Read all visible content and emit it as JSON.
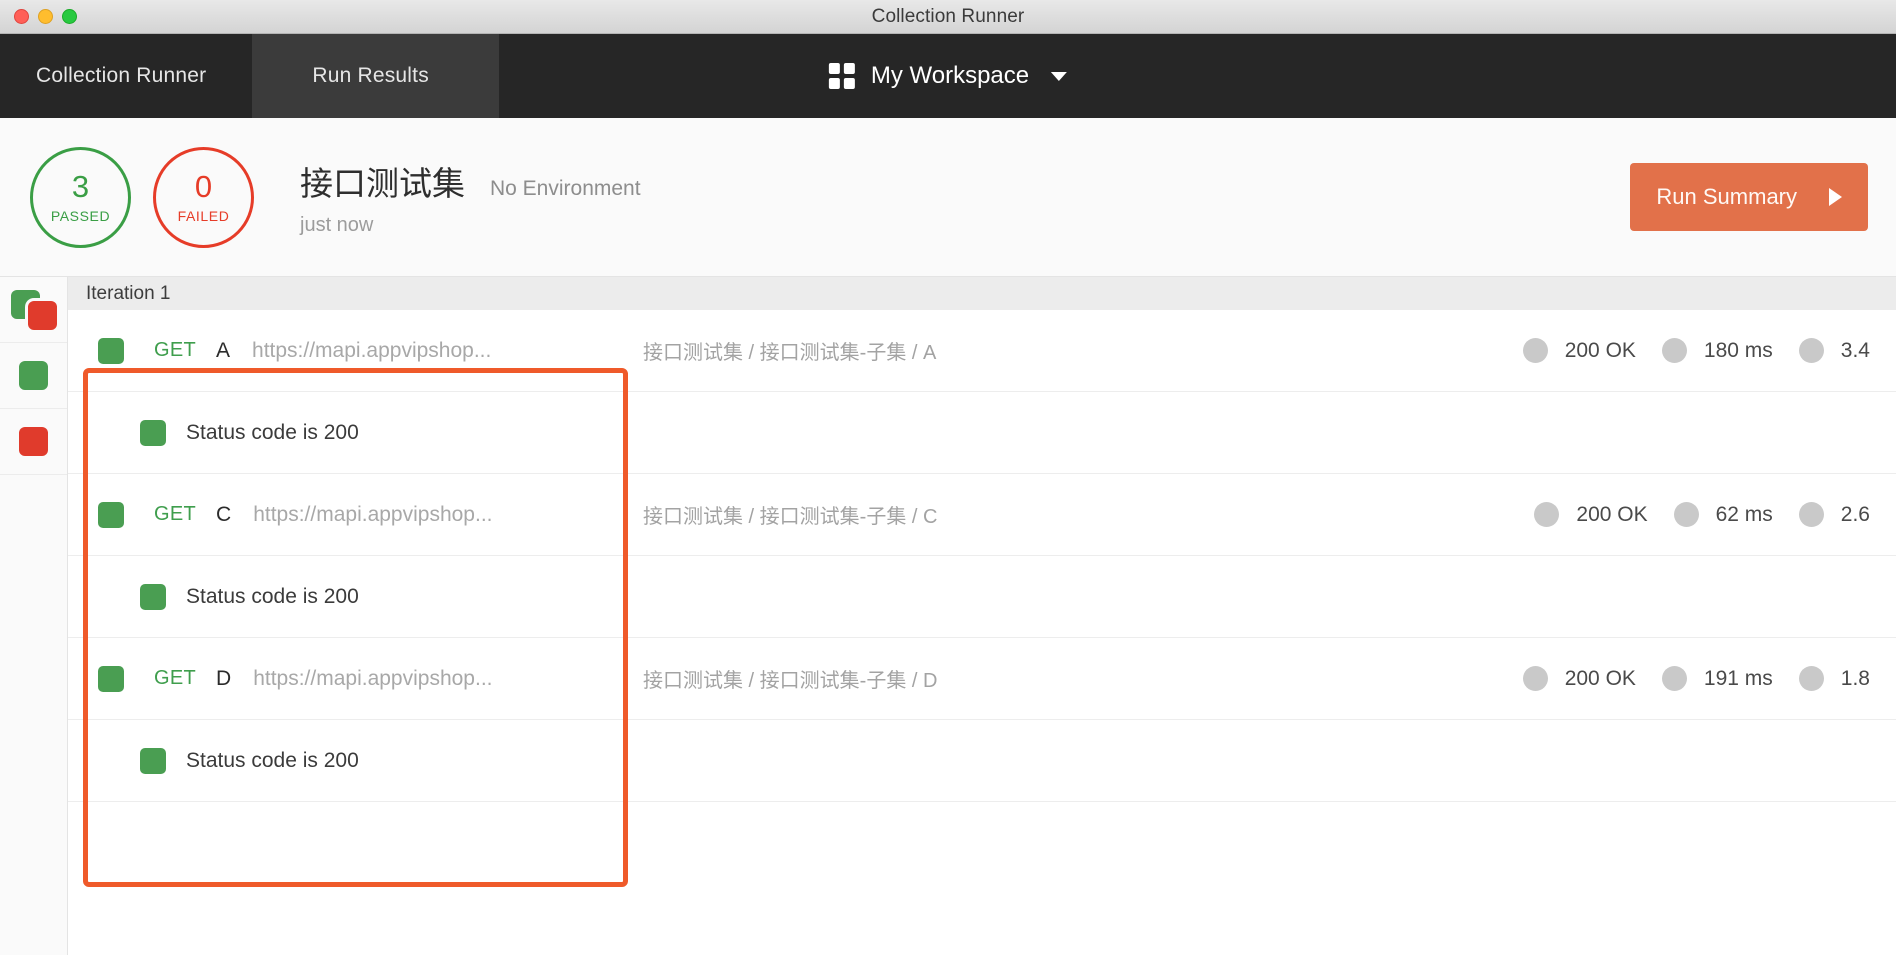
{
  "window": {
    "title": "Collection Runner"
  },
  "traffic_lights": [
    {
      "name": "close",
      "color": "#ff5f57"
    },
    {
      "name": "minimize",
      "color": "#ffbd2e"
    },
    {
      "name": "maximize",
      "color": "#28c940"
    }
  ],
  "navbar": {
    "tabs": [
      {
        "label": "Collection Runner",
        "active": true
      },
      {
        "label": "Run Results",
        "active": false
      }
    ],
    "workspace": {
      "icon": "grid-icon",
      "name": "My Workspace",
      "caret": "chevron-down-icon"
    }
  },
  "summary": {
    "passed": {
      "count": "3",
      "label": "PASSED",
      "color": "#3a9e45"
    },
    "failed": {
      "count": "0",
      "label": "FAILED",
      "color": "#e63c28"
    },
    "collection_name": "接口测试集",
    "environment": "No Environment",
    "timestamp": "just now",
    "run_summary_button": {
      "label": "Run Summary",
      "color": "#e2714a"
    }
  },
  "sidebar": {
    "items": [
      {
        "name": "filter-all",
        "icon": "stacked-squares-icon"
      },
      {
        "name": "filter-passed",
        "icon": "green-square-icon"
      },
      {
        "name": "filter-failed",
        "icon": "red-square-icon"
      }
    ]
  },
  "results": {
    "iteration_label": "Iteration 1",
    "rows": [
      {
        "type": "request",
        "status": "pass",
        "method": "GET",
        "name": "A",
        "url": "https://mapi.appvipshop...",
        "breadcrumb": "接口测试集 / 接口测试集-子集 / A",
        "stats": [
          {
            "label": "200 OK"
          },
          {
            "label": "180 ms"
          },
          {
            "label": "3.4"
          }
        ]
      },
      {
        "type": "test",
        "status": "pass",
        "label": "Status code is 200"
      },
      {
        "type": "request",
        "status": "pass",
        "method": "GET",
        "name": "C",
        "url": "https://mapi.appvipshop...",
        "breadcrumb": "接口测试集 / 接口测试集-子集 / C",
        "stats": [
          {
            "label": "200 OK"
          },
          {
            "label": "62 ms"
          },
          {
            "label": "2.6"
          }
        ]
      },
      {
        "type": "test",
        "status": "pass",
        "label": "Status code is 200"
      },
      {
        "type": "request",
        "status": "pass",
        "method": "GET",
        "name": "D",
        "url": "https://mapi.appvipshop...",
        "breadcrumb": "接口测试集 / 接口测试集-子集 / D",
        "stats": [
          {
            "label": "200 OK"
          },
          {
            "label": "191 ms"
          },
          {
            "label": "1.8"
          }
        ]
      },
      {
        "type": "test",
        "status": "pass",
        "label": "Status code is 200"
      }
    ],
    "highlight_color": "#ef5a2a"
  }
}
